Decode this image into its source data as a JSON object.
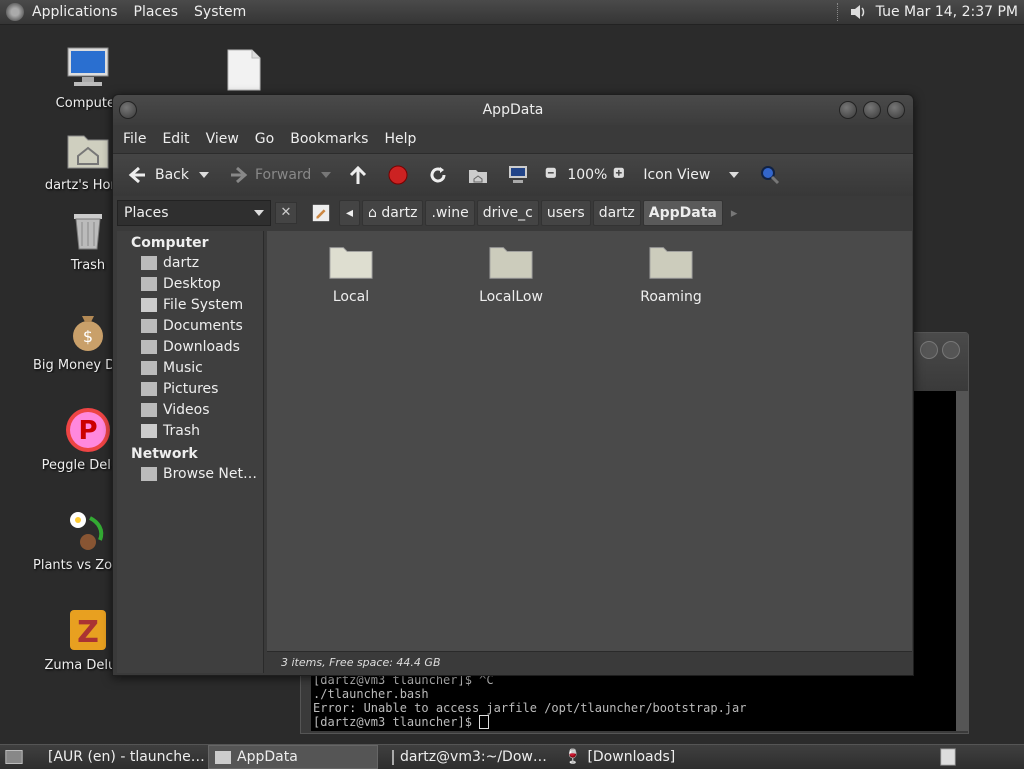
{
  "top_panel": {
    "menus": [
      "Applications",
      "Places",
      "System"
    ],
    "clock": "Tue Mar 14,  2:37 PM"
  },
  "desktop_icons": [
    {
      "label": "Computer",
      "icon": "computer-icon"
    },
    {
      "label": "dartz's Home",
      "icon": "home-folder-icon"
    },
    {
      "label": "Trash",
      "icon": "trash-icon"
    },
    {
      "label": "Big Money Deluxe",
      "icon": "money-bag-icon"
    },
    {
      "label": "Peggle Deluxe",
      "icon": "peggle-icon"
    },
    {
      "label": "Plants vs Zombies",
      "icon": "plants-icon"
    },
    {
      "label": "Zuma Deluxe",
      "icon": "zuma-icon"
    }
  ],
  "file_manager": {
    "title": "AppData",
    "menus": [
      "File",
      "Edit",
      "View",
      "Go",
      "Bookmarks",
      "Help"
    ],
    "toolbar": {
      "back": "Back",
      "forward": "Forward",
      "zoom": "100%",
      "view_mode": "Icon View"
    },
    "places_label": "Places",
    "breadcrumbs": [
      "dartz",
      ".wine",
      "drive_c",
      "users",
      "dartz",
      "AppData"
    ],
    "sidebar": {
      "computer_header": "Computer",
      "computer_items": [
        "dartz",
        "Desktop",
        "File System",
        "Documents",
        "Downloads",
        "Music",
        "Pictures",
        "Videos",
        "Trash"
      ],
      "network_header": "Network",
      "network_items": [
        "Browse Net…"
      ]
    },
    "folders": [
      "Local",
      "LocalLow",
      "Roaming"
    ],
    "status": "3 items, Free space: 44.4 GB"
  },
  "terminal": {
    "lines": [
      "[dartz@vm3 tlauncher]$ ^C",
      "./tlauncher.bash",
      "Error: Unable to access jarfile /opt/tlauncher/bootstrap.jar",
      "[dartz@vm3 tlauncher]$ "
    ]
  },
  "taskbar": {
    "items": [
      "[AUR (en) - tlaunche…",
      "AppData",
      "dartz@vm3:~/Dow…",
      "[Downloads]"
    ]
  }
}
